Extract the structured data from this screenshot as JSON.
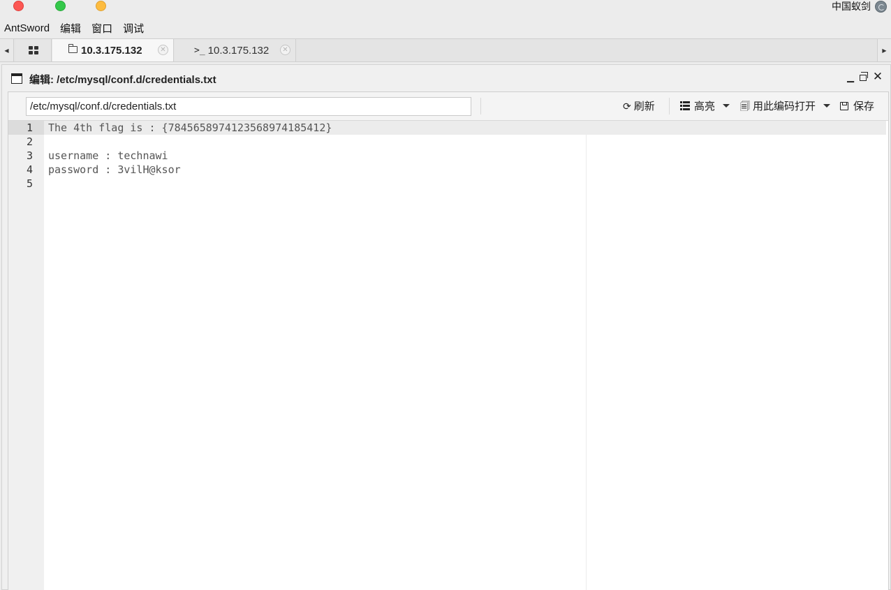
{
  "app": {
    "brand": "中国蚁剑"
  },
  "menu": [
    "AntSword",
    "编辑",
    "窗口",
    "调试"
  ],
  "tabs": [
    {
      "label": "10.3.175.132",
      "icon": "folder-icon"
    },
    {
      "label": "10.3.175.132",
      "icon": "terminal-icon",
      "prefix": ">_"
    }
  ],
  "window": {
    "title": "编辑: /etc/mysql/conf.d/credentials.txt"
  },
  "toolbar": {
    "path": "/etc/mysql/conf.d/credentials.txt",
    "refresh": "刷新",
    "highlight": "高亮",
    "encode_open": "用此编码打开",
    "save": "保存"
  },
  "editor": {
    "line_numbers": [
      "1",
      "2",
      "3",
      "4",
      "5"
    ],
    "lines": [
      "The 4th flag is : {7845658974123568974185412}",
      "",
      "username : technawi",
      "password : 3vilH@ksor",
      ""
    ]
  }
}
